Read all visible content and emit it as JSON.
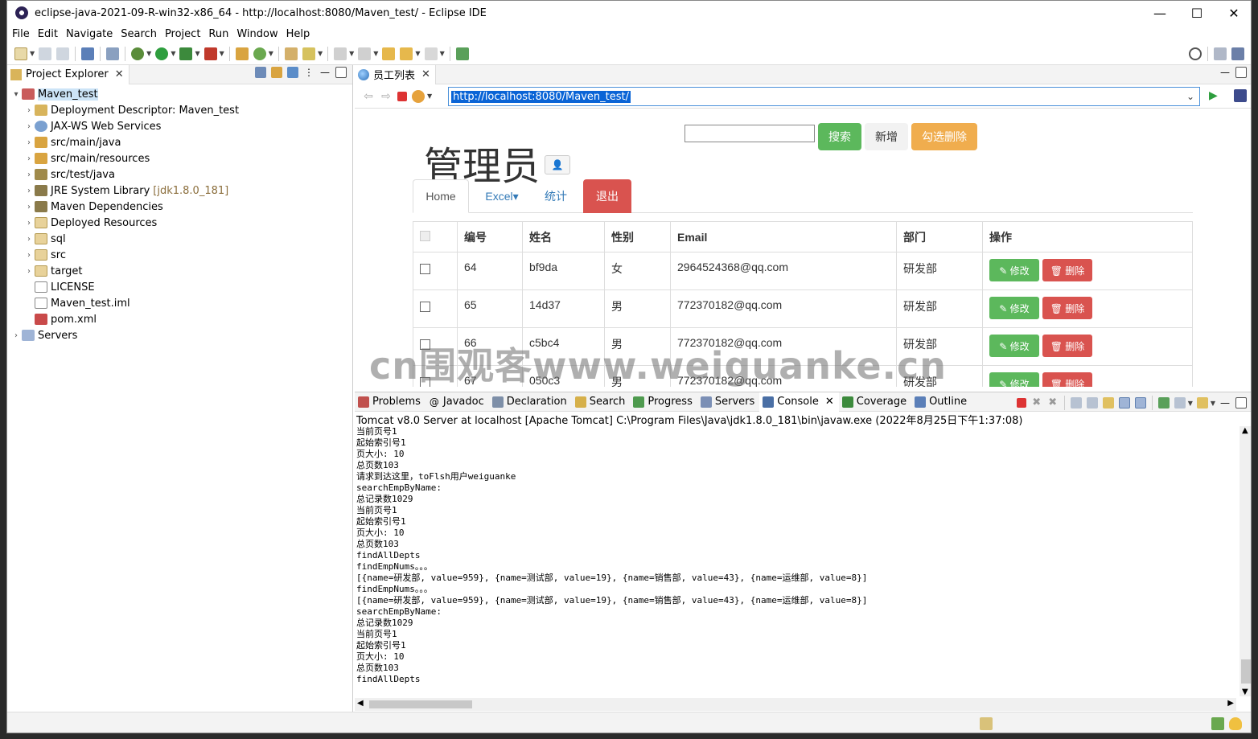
{
  "window": {
    "title": "eclipse-java-2021-09-R-win32-x86_64 - http://localhost:8080/Maven_test/ - Eclipse IDE",
    "minimize": "—",
    "maximize": "☐",
    "close": "✕"
  },
  "menu": [
    "File",
    "Edit",
    "Navigate",
    "Search",
    "Project",
    "Run",
    "Window",
    "Help"
  ],
  "explorer": {
    "tab_label": "Project Explorer",
    "items": [
      {
        "label": "Maven_test",
        "extra": "",
        "indent": 0
      },
      {
        "label": "Deployment Descriptor: Maven_test",
        "extra": "",
        "indent": 1
      },
      {
        "label": "JAX-WS Web Services",
        "extra": "",
        "indent": 1
      },
      {
        "label": "src/main/java",
        "extra": "",
        "indent": 1
      },
      {
        "label": "src/main/resources",
        "extra": "",
        "indent": 1
      },
      {
        "label": "src/test/java",
        "extra": "",
        "indent": 1
      },
      {
        "label": "JRE System Library",
        "extra": "[jdk1.8.0_181]",
        "indent": 1
      },
      {
        "label": "Maven Dependencies",
        "extra": "",
        "indent": 1
      },
      {
        "label": "Deployed Resources",
        "extra": "",
        "indent": 1
      },
      {
        "label": "sql",
        "extra": "",
        "indent": 1
      },
      {
        "label": "src",
        "extra": "",
        "indent": 1
      },
      {
        "label": "target",
        "extra": "",
        "indent": 1
      },
      {
        "label": "LICENSE",
        "extra": "",
        "indent": 1
      },
      {
        "label": "Maven_test.iml",
        "extra": "",
        "indent": 1
      },
      {
        "label": "pom.xml",
        "extra": "",
        "indent": 1
      },
      {
        "label": "Servers",
        "extra": "",
        "indent": 0
      }
    ]
  },
  "editor": {
    "tab_label": "员工列表",
    "url": "http://localhost:8080/Maven_test/"
  },
  "webpage": {
    "title": "管理员",
    "search_value": "",
    "search_button": "搜索",
    "add_button": "新增",
    "delete_selected_button": "勾选删除",
    "tabs": {
      "home": "Home",
      "excel": "Excel▾",
      "stats": "统计",
      "logout": "退出"
    },
    "table": {
      "headers": [
        "",
        "编号",
        "姓名",
        "性别",
        "Email",
        "部门",
        "操作"
      ],
      "edit_label": "✎ 修改",
      "delete_label": "🗑 删除",
      "rows": [
        {
          "id": "64",
          "name": "bf9da",
          "gender": "女",
          "email": "2964524368@qq.com",
          "dept": "研发部"
        },
        {
          "id": "65",
          "name": "14d37",
          "gender": "男",
          "email": "772370182@qq.com",
          "dept": "研发部"
        },
        {
          "id": "66",
          "name": "c5bc4",
          "gender": "男",
          "email": "772370182@qq.com",
          "dept": "研发部"
        },
        {
          "id": "67",
          "name": "050c3",
          "gender": "男",
          "email": "772370182@qq.com",
          "dept": "研发部"
        }
      ]
    }
  },
  "watermark": "cn围观客www.weiguanke.cn",
  "bottom_panel": {
    "tabs": [
      "Problems",
      "Javadoc",
      "Declaration",
      "Search",
      "Progress",
      "Servers",
      "Console",
      "Coverage",
      "Outline"
    ],
    "active_tab": "Console",
    "console_header": "Tomcat v8.0 Server at localhost [Apache Tomcat] C:\\Program Files\\Java\\jdk1.8.0_181\\bin\\javaw.exe  (2022年8月25日下午1:37:08)",
    "console_lines": [
      "当前页号1",
      "起始索引号1",
      "页大小: 10",
      "总页数103",
      "请求到达这里，toFlsh用户weiguanke",
      "searchEmpByName:",
      "总记录数1029",
      "当前页号1",
      "起始索引号1",
      "页大小: 10",
      "总页数103",
      "findAllDepts",
      "findEmpNums。。。",
      "[{name=研发部, value=959}, {name=测试部, value=19}, {name=销售部, value=43}, {name=运维部, value=8}]",
      "findEmpNums。。。",
      "[{name=研发部, value=959}, {name=测试部, value=19}, {name=销售部, value=43}, {name=运维部, value=8}]",
      "searchEmpByName:",
      "总记录数1029",
      "当前页号1",
      "起始索引号1",
      "页大小: 10",
      "总页数103",
      "findAllDepts"
    ]
  },
  "colors": {
    "success": "#5cb85c",
    "danger": "#d9534f",
    "warning": "#f0ad4e",
    "link": "#337ab7",
    "selection": "#cce4f7"
  }
}
